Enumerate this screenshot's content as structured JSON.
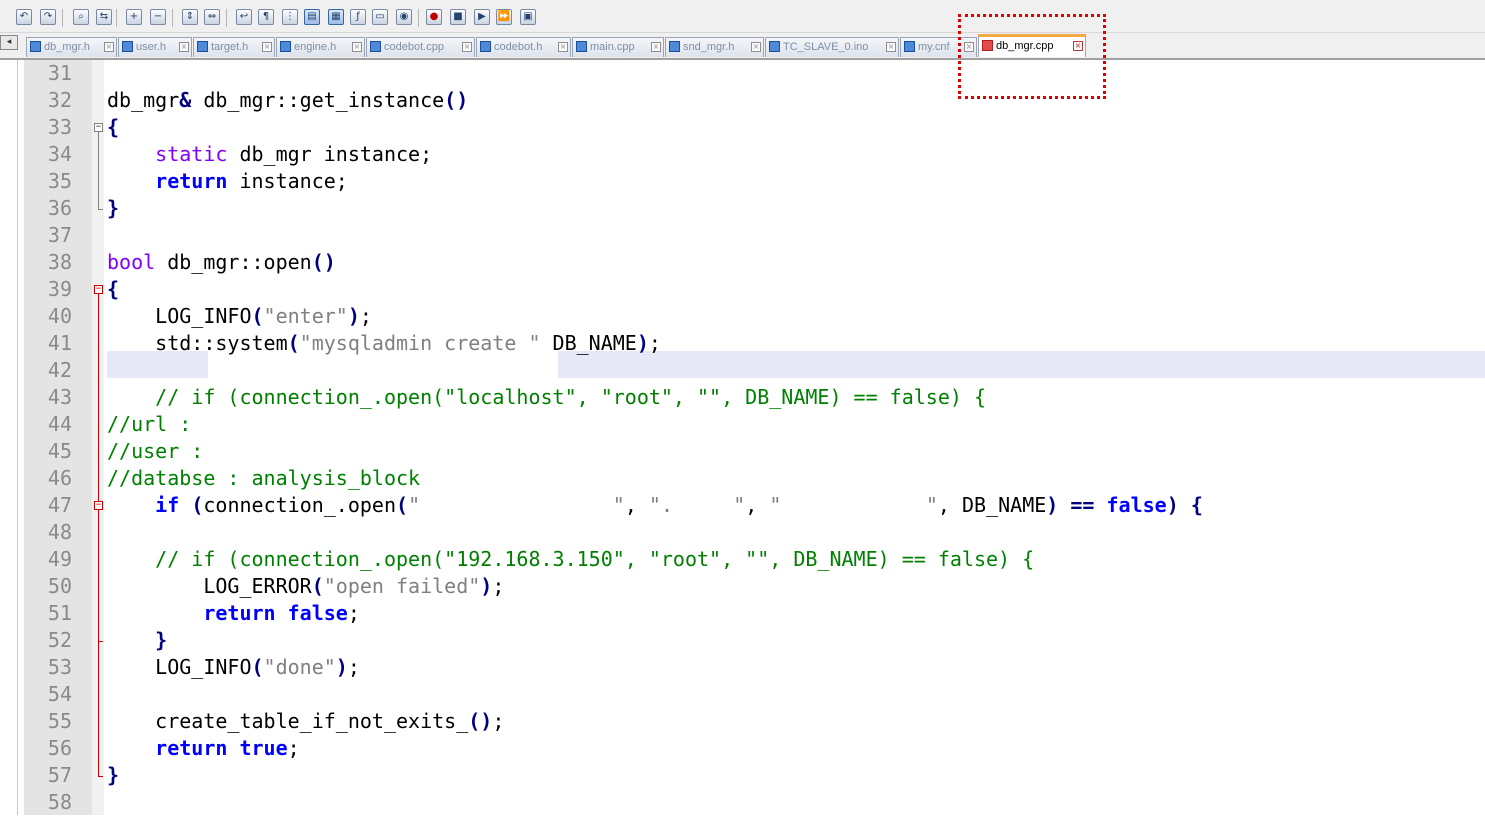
{
  "window": {
    "toolbar_icons": [
      "undo-icon",
      "redo-icon",
      "find-icon",
      "replace-icon",
      "zoom-in-icon",
      "zoom-out-icon",
      "sync-vertical-icon",
      "sync-horizontal-icon",
      "word-wrap-icon",
      "show-all-characters-icon",
      "indent-guide-icon",
      "user-defined-language-icon",
      "document-map-icon",
      "function-list-icon",
      "folder-workspace-icon",
      "monitoring-icon",
      "macro-record-icon",
      "macro-stop-icon",
      "macro-play-icon",
      "macro-run-multiple-icon",
      "macro-save-icon"
    ]
  },
  "tabs": [
    {
      "label": "db_mgr.h",
      "active": false
    },
    {
      "label": "user.h",
      "active": false
    },
    {
      "label": "target.h",
      "active": false
    },
    {
      "label": "engine.h",
      "active": false
    },
    {
      "label": "codebot.cpp",
      "active": false
    },
    {
      "label": "codebot.h",
      "active": false
    },
    {
      "label": "main.cpp",
      "active": false
    },
    {
      "label": "snd_mgr.h",
      "active": false
    },
    {
      "label": "TC_SLAVE_0.ino",
      "active": false
    },
    {
      "label": "my.cnf",
      "active": false
    },
    {
      "label": "db_mgr.cpp",
      "active": true
    }
  ],
  "colors": {
    "keyword": "#0000ff",
    "type": "#8000ff",
    "string": "#808080",
    "comment": "#008000",
    "annotation_box": "#e00000",
    "active_tab_accent": "#f7a945"
  },
  "editor": {
    "lines": [
      {
        "n": "31",
        "segs": []
      },
      {
        "n": "32",
        "segs": [
          [
            "t",
            "db_mgr"
          ],
          [
            "o",
            "&"
          ],
          [
            "t",
            " db_mgr::get_instance"
          ],
          [
            "o",
            "()"
          ]
        ]
      },
      {
        "n": "33",
        "segs": [
          [
            "o",
            "{"
          ]
        ]
      },
      {
        "n": "34",
        "segs": [
          [
            "t",
            "    "
          ],
          [
            "y",
            "static"
          ],
          [
            "t",
            " db_mgr instance;"
          ]
        ]
      },
      {
        "n": "35",
        "segs": [
          [
            "t",
            "    "
          ],
          [
            "k",
            "return"
          ],
          [
            "t",
            " instance;"
          ]
        ]
      },
      {
        "n": "36",
        "segs": [
          [
            "o",
            "}"
          ]
        ]
      },
      {
        "n": "37",
        "segs": []
      },
      {
        "n": "38",
        "segs": [
          [
            "y",
            "bool"
          ],
          [
            "t",
            " db_mgr::open"
          ],
          [
            "o",
            "()"
          ]
        ]
      },
      {
        "n": "39",
        "segs": [
          [
            "o",
            "{"
          ]
        ]
      },
      {
        "n": "40",
        "segs": [
          [
            "t",
            "    LOG_INFO"
          ],
          [
            "o",
            "("
          ],
          [
            "s",
            "\"enter\""
          ],
          [
            "o",
            ")"
          ],
          [
            "t",
            ";"
          ]
        ]
      },
      {
        "n": "41",
        "segs": [
          [
            "t",
            "    std::system"
          ],
          [
            "o",
            "("
          ],
          [
            "s",
            "\"mysqladmin create \""
          ],
          [
            "t",
            " DB_NAME"
          ],
          [
            "o",
            ")"
          ],
          [
            "t",
            ";"
          ]
        ]
      },
      {
        "n": "42",
        "segs": []
      },
      {
        "n": "43",
        "segs": [
          [
            "t",
            "    "
          ],
          [
            "c",
            "// if (connection_.open(\"localhost\", \"root\", \"\", DB_NAME) == false) {"
          ]
        ]
      },
      {
        "n": "44",
        "segs": [
          [
            "c",
            "//url :"
          ]
        ]
      },
      {
        "n": "45",
        "segs": [
          [
            "c",
            "//user :"
          ]
        ]
      },
      {
        "n": "46",
        "segs": [
          [
            "c",
            "//databse : analysis_block"
          ]
        ]
      },
      {
        "n": "47",
        "segs": [
          [
            "t",
            "    "
          ],
          [
            "k",
            "if"
          ],
          [
            "t",
            " "
          ],
          [
            "o",
            "("
          ],
          [
            "t",
            "connection_.open"
          ],
          [
            "o",
            "("
          ],
          [
            "s",
            "\"                \""
          ],
          [
            "t",
            ", "
          ],
          [
            "s",
            "\".     \""
          ],
          [
            "t",
            ", "
          ],
          [
            "s",
            "\"            \""
          ],
          [
            "t",
            ", DB_NAME"
          ],
          [
            "o",
            ")"
          ],
          [
            "t",
            " "
          ],
          [
            "o",
            "=="
          ],
          [
            "t",
            " "
          ],
          [
            "k",
            "false"
          ],
          [
            "o",
            ")"
          ],
          [
            "t",
            " "
          ],
          [
            "o",
            "{"
          ]
        ]
      },
      {
        "n": "48",
        "segs": []
      },
      {
        "n": "49",
        "segs": [
          [
            "t",
            "    "
          ],
          [
            "c",
            "// if (connection_.open(\"192.168.3.150\", \"root\", \"\", DB_NAME) == false) {"
          ]
        ]
      },
      {
        "n": "50",
        "segs": [
          [
            "t",
            "        LOG_ERROR"
          ],
          [
            "o",
            "("
          ],
          [
            "s",
            "\"open failed\""
          ],
          [
            "o",
            ")"
          ],
          [
            "t",
            ";"
          ]
        ]
      },
      {
        "n": "51",
        "segs": [
          [
            "t",
            "        "
          ],
          [
            "k",
            "return"
          ],
          [
            "t",
            " "
          ],
          [
            "k",
            "false"
          ],
          [
            "t",
            ";"
          ]
        ]
      },
      {
        "n": "52",
        "segs": [
          [
            "t",
            "    "
          ],
          [
            "o",
            "}"
          ]
        ]
      },
      {
        "n": "53",
        "segs": [
          [
            "t",
            "    LOG_INFO"
          ],
          [
            "o",
            "("
          ],
          [
            "s",
            "\"done\""
          ],
          [
            "o",
            ")"
          ],
          [
            "t",
            ";"
          ]
        ]
      },
      {
        "n": "54",
        "segs": []
      },
      {
        "n": "55",
        "segs": [
          [
            "t",
            "    create_table_if_not_exits_"
          ],
          [
            "o",
            "()"
          ],
          [
            "t",
            ";"
          ]
        ]
      },
      {
        "n": "56",
        "segs": [
          [
            "t",
            "    "
          ],
          [
            "k",
            "return"
          ],
          [
            "t",
            " "
          ],
          [
            "k",
            "true"
          ],
          [
            "t",
            ";"
          ]
        ]
      },
      {
        "n": "57",
        "segs": [
          [
            "o",
            "}"
          ]
        ]
      },
      {
        "n": "58",
        "segs": []
      }
    ]
  }
}
